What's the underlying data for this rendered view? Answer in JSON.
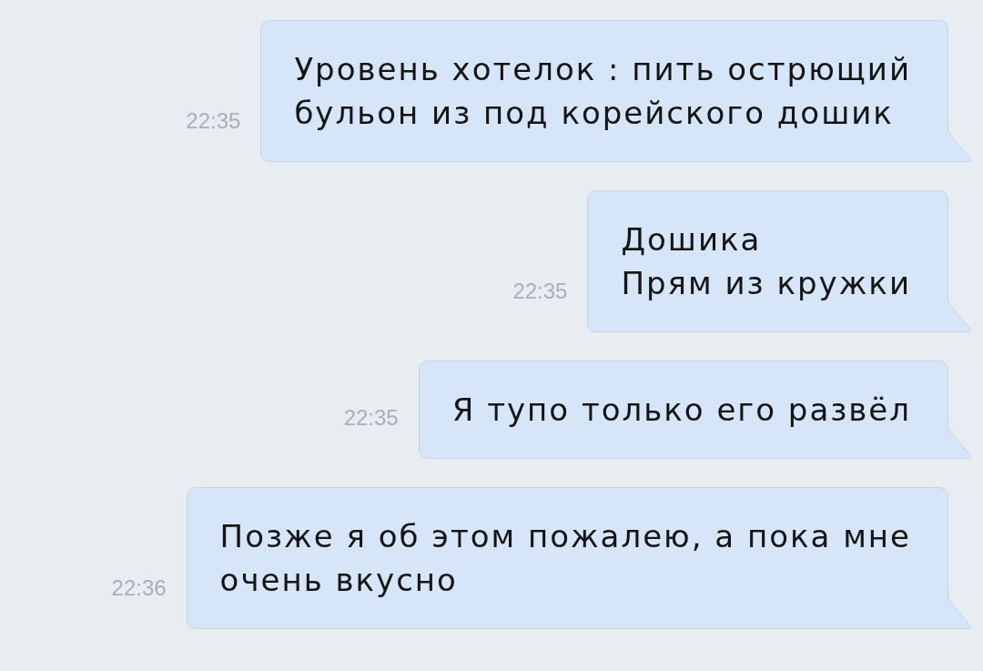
{
  "messages": [
    {
      "time": "22:35",
      "text": "Уровень хотелок : пить острющий\nбульон из под корейского дошик"
    },
    {
      "time": "22:35",
      "text": "Дошика\nПрям из кружки"
    },
    {
      "time": "22:35",
      "text": "Я тупо только его развёл"
    },
    {
      "time": "22:36",
      "text": "Позже я об этом пожалею, а пока мне\nочень вкусно"
    }
  ]
}
